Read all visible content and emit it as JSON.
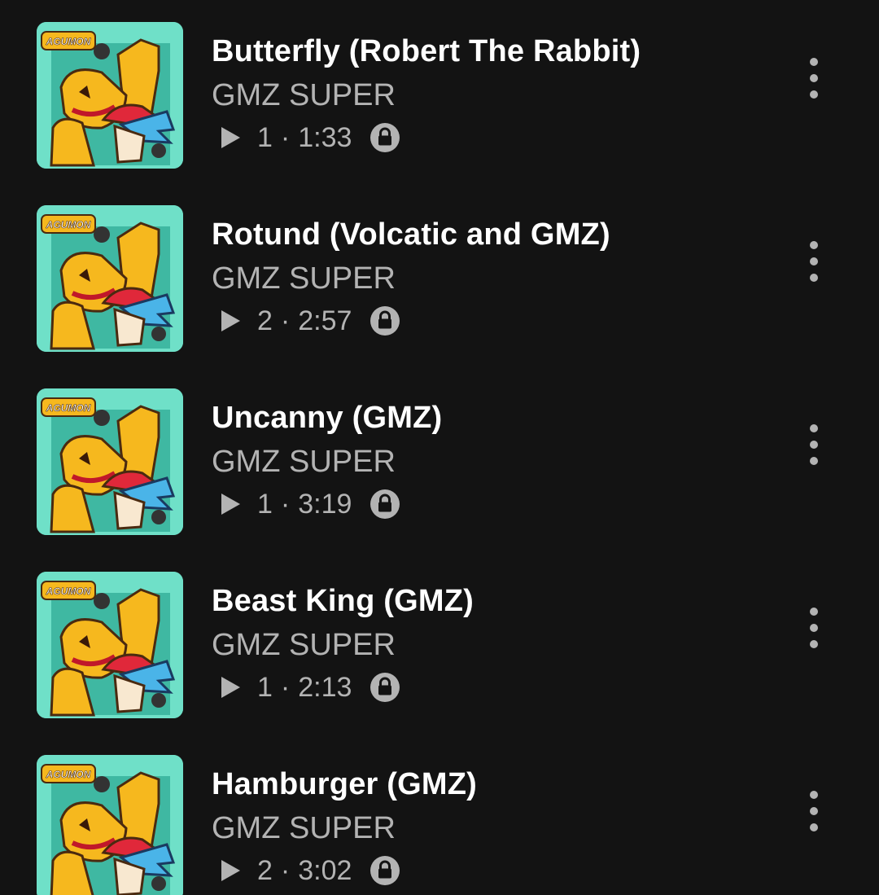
{
  "tracks": [
    {
      "title": "Butterfly (Robert The Rabbit)",
      "artist": "GMZ SUPER",
      "plays": "1",
      "separator": "·",
      "duration": "1:33",
      "thumb_label": "AGUMON"
    },
    {
      "title": "Rotund (Volcatic and GMZ)",
      "artist": "GMZ SUPER",
      "plays": "2",
      "separator": "·",
      "duration": "2:57",
      "thumb_label": "AGUMON"
    },
    {
      "title": "Uncanny (GMZ)",
      "artist": "GMZ SUPER",
      "plays": "1",
      "separator": "·",
      "duration": "3:19",
      "thumb_label": "AGUMON"
    },
    {
      "title": "Beast King (GMZ)",
      "artist": "GMZ SUPER",
      "plays": "1",
      "separator": "·",
      "duration": "2:13",
      "thumb_label": "AGUMON"
    },
    {
      "title": "Hamburger (GMZ)",
      "artist": "GMZ SUPER",
      "plays": "2",
      "separator": "·",
      "duration": "3:02",
      "thumb_label": "AGUMON"
    }
  ],
  "icons": {
    "play": "play-icon",
    "lock": "lock-icon",
    "more": "more-vertical-icon"
  },
  "colors": {
    "background": "#131313",
    "title": "#ffffff",
    "secondary": "#b3b3b3",
    "thumb_bg": "#6fe0c8"
  }
}
